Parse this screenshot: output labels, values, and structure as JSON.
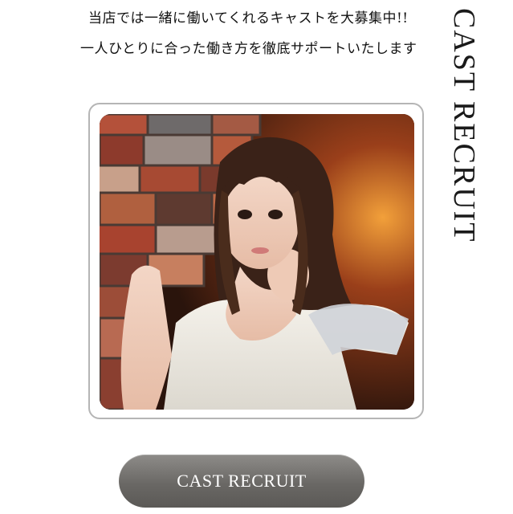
{
  "intro": {
    "line1": "当店では一緒に働いてくれるキャストを大募集中!!",
    "line2": "一人ひとりに合った働き方を徹底サポートいたします"
  },
  "side_title": "CAST RECRUIT",
  "button": {
    "label": "CAST RECRUIT"
  },
  "colors": {
    "button_gradient_top": "#8e8c89",
    "button_gradient_bottom": "#5b5956",
    "frame_border": "#b5b5b5"
  }
}
